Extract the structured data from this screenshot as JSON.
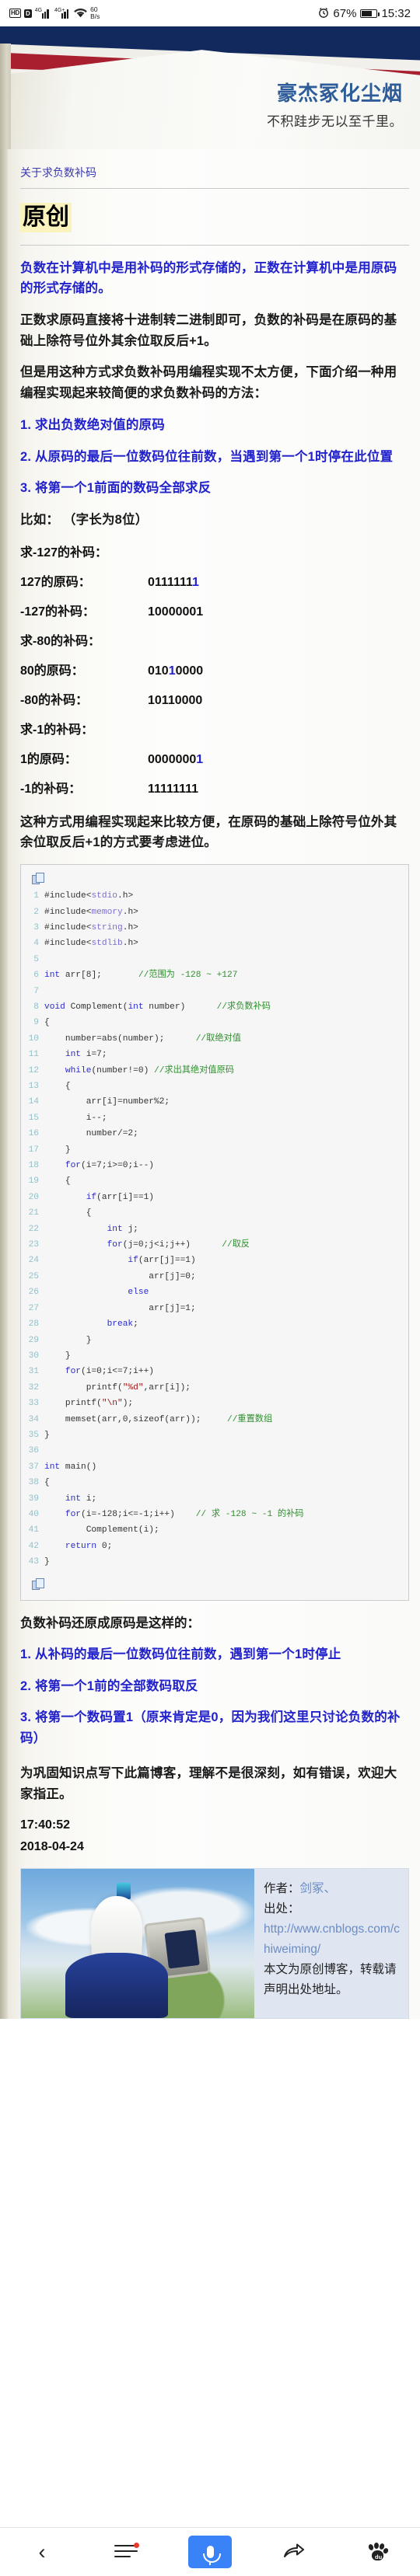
{
  "statusbar": {
    "hd_icon": "HD",
    "d_icon": "D",
    "sim1_label": "4G",
    "sim2_label": "4G+",
    "wifi_icon": "wifi-icon",
    "netspeed_value": "60",
    "netspeed_unit": "B/s",
    "alarm_icon": "alarm-icon",
    "battery_percent": "67%",
    "clock": "15:32"
  },
  "banner": {
    "title": "豪杰冢化尘烟",
    "subtitle": "不积跬步无以至千里。"
  },
  "article": {
    "breadcrumb": "关于求负数补码",
    "original_badge": "原创",
    "paragraphs": [
      "负数在计算机中是用补码的形式存储的，正数在计算机中是用原码的形式存储的。",
      "正数求原码直接将十进制转二进制即可，负数的补码是在原码的基础上除符号位外其余位取反后+1。",
      "但是用这种方式求负数补码用编程实现不太方便，下面介绍一种用编程实现起来较简便的求负数补码的方法："
    ],
    "steps": [
      "1. 求出负数绝对值的原码",
      "2. 从原码的最后一位数码位往前数，当遇到第一个1时停在此位置",
      "3. 将第一个1前面的数码全部求反"
    ],
    "example_intro": "比如：  （字长为8位）",
    "examples": [
      {
        "heading": "求-127的补码：",
        "rows": [
          {
            "label": "127的原码：",
            "prefix": "0111111",
            "highlight": "1",
            "suffix": ""
          },
          {
            "label": "-127的补码：",
            "prefix": "10000001",
            "highlight": "",
            "suffix": ""
          }
        ]
      },
      {
        "heading": "求-80的补码：",
        "rows": [
          {
            "label": "80的原码：",
            "prefix": "010",
            "highlight": "1",
            "suffix": "0000"
          },
          {
            "label": "-80的补码：",
            "prefix": "10110000",
            "highlight": "",
            "suffix": ""
          }
        ]
      },
      {
        "heading": "求-1的补码：",
        "rows": [
          {
            "label": "1的原码：",
            "prefix": "0000000",
            "highlight": "1",
            "suffix": ""
          },
          {
            "label": "-1的补码：",
            "prefix": "11111111",
            "highlight": "",
            "suffix": ""
          }
        ]
      }
    ],
    "after_examples": "这种方式用编程实现起来比较方便，在原码的基础上除符号位外其余位取反后+1的方式要考虑进位。",
    "restore_title": "负数补码还原成原码是这样的：",
    "restore_steps": [
      "1. 从补码的最后一位数码位往前数，遇到第一个1时停止",
      "2. 将第一个1前的全部数码取反",
      "3. 将第一个数码置1（原来肯定是0，因为我们这里只讨论负数的补码）"
    ],
    "closing": "为巩固知识点写下此篇博客，理解不是很深刻，如有错误，欢迎大家指正。",
    "time": "17:40:52",
    "date": "2018-04-24"
  },
  "code": {
    "copy_icon_top": "copy-icon",
    "copy_icon_bottom": "copy-icon",
    "lines": [
      {
        "n": "1",
        "text": "#include<stdio.h>"
      },
      {
        "n": "2",
        "text": "#include<memory.h>"
      },
      {
        "n": "3",
        "text": "#include<string.h>"
      },
      {
        "n": "4",
        "text": "#include<stdlib.h>"
      },
      {
        "n": "5",
        "text": ""
      },
      {
        "n": "6",
        "text": "int arr[8];       //范围为 -128 ~ +127"
      },
      {
        "n": "7",
        "text": ""
      },
      {
        "n": "8",
        "text": "void Complement(int number)      //求负数补码"
      },
      {
        "n": "9",
        "text": "{"
      },
      {
        "n": "10",
        "text": "    number=abs(number);      //取绝对值"
      },
      {
        "n": "11",
        "text": "    int i=7;"
      },
      {
        "n": "12",
        "text": "    while(number!=0) //求出其绝对值原码"
      },
      {
        "n": "13",
        "text": "    {"
      },
      {
        "n": "14",
        "text": "        arr[i]=number%2;"
      },
      {
        "n": "15",
        "text": "        i--;"
      },
      {
        "n": "16",
        "text": "        number/=2;"
      },
      {
        "n": "17",
        "text": "    }"
      },
      {
        "n": "18",
        "text": "    for(i=7;i>=0;i--)"
      },
      {
        "n": "19",
        "text": "    {"
      },
      {
        "n": "20",
        "text": "        if(arr[i]==1)"
      },
      {
        "n": "21",
        "text": "        {"
      },
      {
        "n": "22",
        "text": "            int j;"
      },
      {
        "n": "23",
        "text": "            for(j=0;j<i;j++)      //取反"
      },
      {
        "n": "24",
        "text": "                if(arr[j]==1)"
      },
      {
        "n": "25",
        "text": "                    arr[j]=0;"
      },
      {
        "n": "26",
        "text": "                else"
      },
      {
        "n": "27",
        "text": "                    arr[j]=1;"
      },
      {
        "n": "28",
        "text": "            break;"
      },
      {
        "n": "29",
        "text": "        }"
      },
      {
        "n": "30",
        "text": "    }"
      },
      {
        "n": "31",
        "text": "    for(i=0;i<=7;i++)"
      },
      {
        "n": "32",
        "text": "        printf(\"%d\",arr[i]);"
      },
      {
        "n": "33",
        "text": "    printf(\"\\n\");"
      },
      {
        "n": "34",
        "text": "    memset(arr,0,sizeof(arr));     //重置数组"
      },
      {
        "n": "35",
        "text": "}"
      },
      {
        "n": "36",
        "text": ""
      },
      {
        "n": "37",
        "text": "int main()"
      },
      {
        "n": "38",
        "text": "{"
      },
      {
        "n": "39",
        "text": "    int i;"
      },
      {
        "n": "40",
        "text": "    for(i=-128;i<=-1;i++)    // 求 -128 ~ -1 的补码"
      },
      {
        "n": "41",
        "text": "        Complement(i);"
      },
      {
        "n": "42",
        "text": "    return 0;"
      },
      {
        "n": "43",
        "text": "}"
      }
    ]
  },
  "author_card": {
    "image_alt": "anime-character-photo",
    "author_label": "作者：",
    "author_name": "剑冢、",
    "source_label": "出处：",
    "source_url": "http://www.cnblogs.com/chiweiming/",
    "notice": "本文为原创博客，转载请声明出处地址。"
  },
  "bottomnav": {
    "back_icon": "back-chevron-icon",
    "menu_icon": "menu-icon",
    "mic_icon": "microphone-icon",
    "share_icon": "share-icon",
    "baidu_icon": "baidu-paw-icon",
    "baidu_label": "du"
  },
  "colors": {
    "banner_navy": "#11295c",
    "banner_red": "#a8202f",
    "title_blue": "#2e5c99",
    "link_blue": "#2222cc",
    "highlight_yellow": "#fbf3bd",
    "accent_blue": "#3a82f7"
  }
}
